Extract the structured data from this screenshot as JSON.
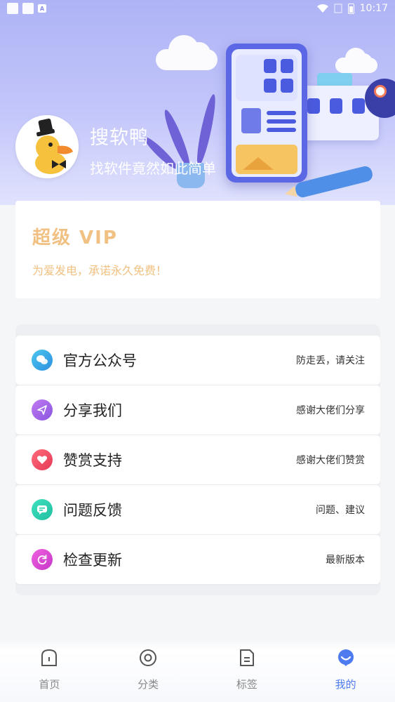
{
  "status_bar": {
    "time": "10:17",
    "icons": [
      "notification-icon",
      "notification-icon",
      "accessibility-icon",
      "wifi-icon",
      "signal-icon",
      "battery-icon"
    ]
  },
  "profile": {
    "name": "搜软鸭",
    "slogan": "找软件竟然如此简单"
  },
  "vip": {
    "title": "超级 VIP",
    "subtitle": "为爱发电，承诺永久免费！",
    "color": "#f1c183"
  },
  "menu": [
    {
      "label": "官方公众号",
      "hint": "防走丢，请关注",
      "icon": "wechat-icon",
      "color": "#3ab0e6"
    },
    {
      "label": "分享我们",
      "hint": "感谢大佬们分享",
      "icon": "send-icon",
      "color": "#9b63e6"
    },
    {
      "label": "赞赏支持",
      "hint": "感谢大佬们赞赏",
      "icon": "heart-icon",
      "color": "#f04a62"
    },
    {
      "label": "问题反馈",
      "hint": "问题、建议",
      "icon": "message-icon",
      "color": "#25cfb0"
    },
    {
      "label": "检查更新",
      "hint": "最新版本",
      "icon": "refresh-icon",
      "color": "#e24bd6"
    }
  ],
  "nav": [
    {
      "label": "首页",
      "icon": "home-icon",
      "active": false
    },
    {
      "label": "分类",
      "icon": "category-icon",
      "active": false
    },
    {
      "label": "标签",
      "icon": "tag-icon",
      "active": false
    },
    {
      "label": "我的",
      "icon": "profile-icon",
      "active": true
    }
  ],
  "colors": {
    "accent": "#4f7bf0",
    "header_top": "#aeb3f5"
  }
}
